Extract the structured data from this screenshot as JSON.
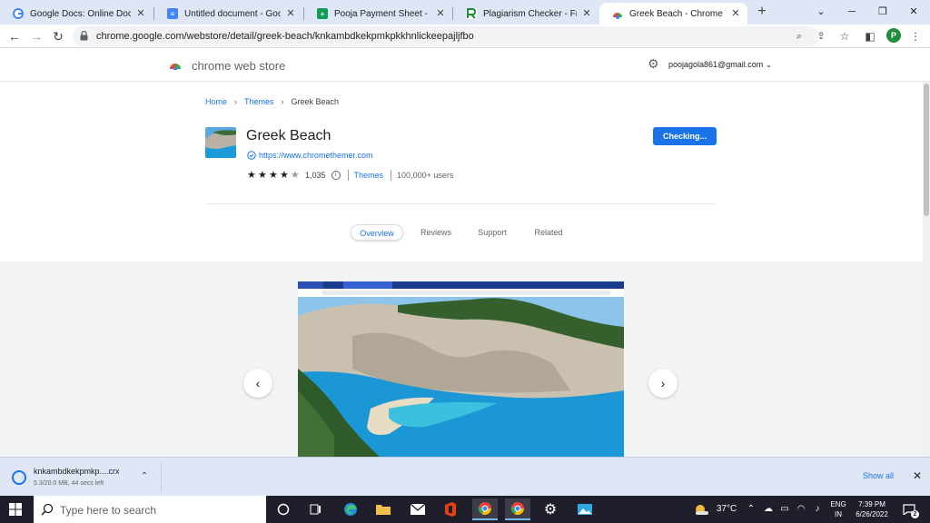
{
  "browser": {
    "tabs": [
      {
        "label": "Google Docs: Online Document",
        "icon": "google-icon"
      },
      {
        "label": "Untitled document - Google Docs",
        "icon": "docs-icon"
      },
      {
        "label": "Pooja Payment Sheet - Google Sheets",
        "icon": "sheets-icon"
      },
      {
        "label": "Plagiarism Checker - Free & Accurate",
        "icon": "plagiarism-icon"
      },
      {
        "label": "Greek Beach - Chrome Web Store",
        "icon": "webstore-icon",
        "active": true
      }
    ],
    "close_glyph": "✕",
    "new_tab_glyph": "+",
    "url": "chrome.google.com/webstore/detail/greek-beach/knkambdkekpmkpkkhnlickeepajljfbo",
    "profile_initial": "P"
  },
  "store": {
    "name": "chrome web store",
    "account_email": "poojagola861@gmail.com",
    "account_chevron": "⌄"
  },
  "breadcrumb": {
    "home": "Home",
    "themes": "Themes",
    "current": "Greek Beach",
    "sep": "›"
  },
  "item": {
    "title": "Greek Beach",
    "site": "https://www.chromethemer.com",
    "rating_value": 4,
    "rating_count": "1,035",
    "category": "Themes",
    "users": "100,000+ users",
    "action_label": "Checking..."
  },
  "detail_tabs": [
    "Overview",
    "Reviews",
    "Support",
    "Related"
  ],
  "gallery": {
    "prev_glyph": "‹",
    "next_glyph": "›"
  },
  "download": {
    "filename": "knkambdkekpmkp....crx",
    "status": "5.3/20.0 MB, 44 secs left",
    "show_all": "Show all",
    "chevron": "⌃"
  },
  "taskbar": {
    "search_placeholder": "Type here to search",
    "temperature": "37°C",
    "lang_line1": "ENG",
    "lang_line2": "IN",
    "time": "7:39 PM",
    "date": "6/26/2022",
    "notifications": "2"
  },
  "colors": {
    "accent": "#1a73e8",
    "tabstrip": "#dfe7f6",
    "taskbar": "#1f1f2b"
  }
}
